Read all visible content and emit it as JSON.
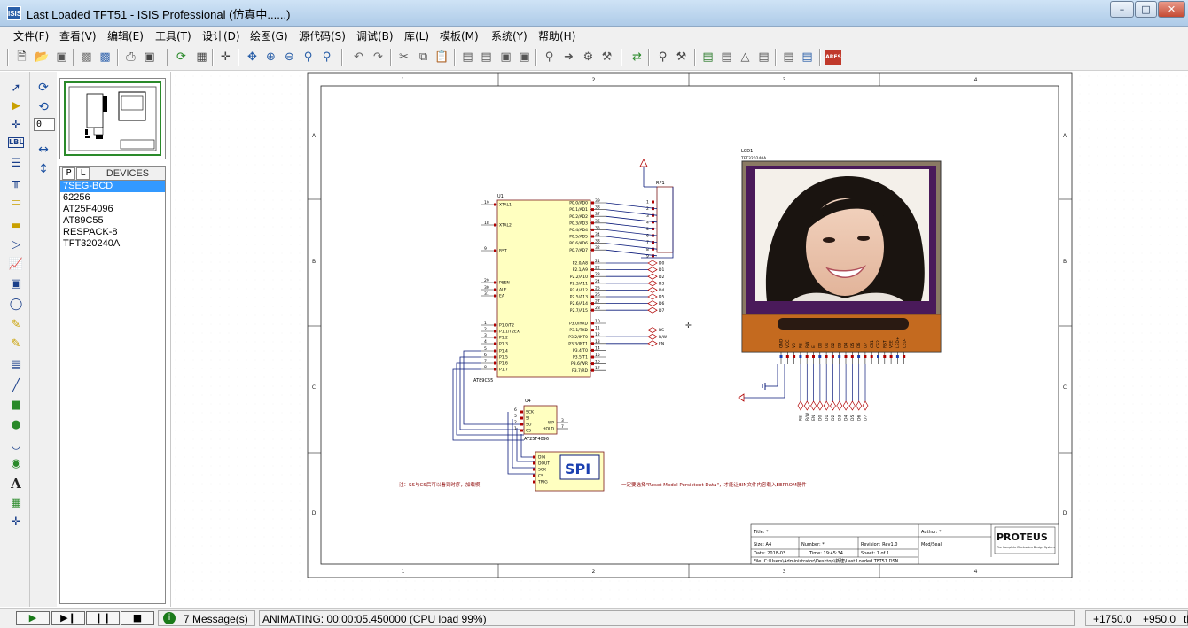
{
  "window": {
    "title": "Last Loaded TFT51 - ISIS Professional (仿真中......)",
    "app_icon_text": "ISIS",
    "controls": [
      "minimize",
      "restore",
      "close"
    ]
  },
  "menu": [
    "文件(F)",
    "查看(V)",
    "编辑(E)",
    "工具(T)",
    "设计(D)",
    "绘图(G)",
    "源代码(S)",
    "调试(B)",
    "库(L)",
    "模板(M)",
    "系统(Y)",
    "帮助(H)"
  ],
  "toolbar": {
    "ares_label": "ARES"
  },
  "side_tools": {
    "lbl_label": "LBL",
    "text_tool": "A",
    "rotation_value": "0"
  },
  "devices": {
    "p_button": "P",
    "l_button": "L",
    "header": "DEVICES",
    "items": [
      "7SEG-BCD",
      "62256",
      "AT25F4096",
      "AT89C55",
      "RESPACK-8",
      "TFT320240A"
    ],
    "selected_index": 0
  },
  "schematic": {
    "border_columns": [
      "1",
      "2",
      "3",
      "4"
    ],
    "border_rows": [
      "A",
      "B",
      "C",
      "D"
    ],
    "u1_ref": "U1",
    "u1_part": "AT89C55",
    "u1_left_pins": [
      "XTAL1",
      "XTAL2",
      "RST",
      "PSEN",
      "ALE",
      "EA",
      "P1.0/T2",
      "P1.1/T2EX",
      "P1.2",
      "P1.3",
      "P1.4",
      "P1.5",
      "P1.6",
      "P1.7"
    ],
    "u1_left_pin_numbers": [
      "19",
      "18",
      "9",
      "29",
      "30",
      "31",
      "1",
      "2",
      "3",
      "4",
      "5",
      "6",
      "7",
      "8"
    ],
    "u1_right_pins": [
      "P0.0/AD0",
      "P0.1/AD1",
      "P0.2/AD2",
      "P0.3/AD3",
      "P0.4/AD4",
      "P0.5/AD5",
      "P0.6/AD6",
      "P0.7/AD7",
      "P2.0/A8",
      "P2.1/A9",
      "P2.2/A10",
      "P2.3/A11",
      "P2.4/A12",
      "P2.5/A13",
      "P2.6/A14",
      "P2.7/A15",
      "P3.0/RXD",
      "P3.1/TXD",
      "P3.2/INT0",
      "P3.3/INT1",
      "P3.4/T0",
      "P3.5/T1",
      "P3.6/WR",
      "P3.7/RD"
    ],
    "u1_right_pin_numbers": [
      "39",
      "38",
      "37",
      "36",
      "35",
      "34",
      "33",
      "32",
      "21",
      "22",
      "23",
      "24",
      "25",
      "26",
      "27",
      "28",
      "10",
      "11",
      "12",
      "13",
      "14",
      "15",
      "16",
      "17"
    ],
    "rp1_ref": "RP1",
    "rp1_pins": [
      "1",
      "2",
      "3",
      "4",
      "5",
      "6",
      "7",
      "8",
      "9"
    ],
    "bus_labels": [
      "D0",
      "D1",
      "D2",
      "D3",
      "D4",
      "D5",
      "D6",
      "D7",
      "RS",
      "R/W",
      "EN"
    ],
    "u4_ref": "U4",
    "u4_part": "AT25F4096",
    "u4_pins": [
      "SCK",
      "SI",
      "SO",
      "CS",
      "WP",
      "HOLD"
    ],
    "u4_pin_numbers": [
      "6",
      "5",
      "2",
      "1",
      "3",
      "7"
    ],
    "spi_label": "SPI",
    "spi_pins": [
      "DIN",
      "DOUT",
      "SCK",
      "CS",
      "TRIG"
    ],
    "note_left": "注：SS与CS后可以看到时序，加载模",
    "note_right": "一定要选择\"Reset Model Persistent Data\"，才能让BIN文件内容载入EEPROM器件",
    "lcd_ref": "LCD1",
    "lcd_part": "TFT320240A",
    "lcd_pins": [
      "GND",
      "VCC",
      "V0",
      "RS",
      "RW",
      "E",
      "D0",
      "D1",
      "D2",
      "D3",
      "D4",
      "D5",
      "D6",
      "D7",
      "CS1",
      "CS2",
      "RST",
      "VEE",
      "LED+",
      "LED-"
    ],
    "lcd_bus_labels": [
      "RS",
      "R/W",
      "EN",
      "D0",
      "D1",
      "D2",
      "D3",
      "D4",
      "D5",
      "D6",
      "D7"
    ],
    "title_block": {
      "title": "Title: *",
      "author": "Author: *",
      "size": "Size: A4",
      "number": "Number: *",
      "revision": "Revision: Rev1.0",
      "date": "Date: 2018-03",
      "time": "Time: 19:45:34",
      "sheet": "Sheet: 1 of 1",
      "file": "File: C:\\Users\\Administrator\\Desktop\\新建\\Last Loaded TFT51.DSN",
      "mod": "Mod/Seal:",
      "logo": "PROTEUS",
      "logo_sub": "The Complete Electronics Design System"
    }
  },
  "statusbar": {
    "messages": "7 Message(s)",
    "animating": "ANIMATING: 00:00:05.450000 (CPU load 99%)",
    "x_coord": "+1750.0",
    "y_coord": "+950.0",
    "unit": "th"
  },
  "colors": {
    "selection": "#3399ff",
    "wire": "#0a1a7a",
    "pin_red": "#b00000",
    "chip_fill": "#ffffc0",
    "lcd_bezel": "#c46a1f"
  }
}
